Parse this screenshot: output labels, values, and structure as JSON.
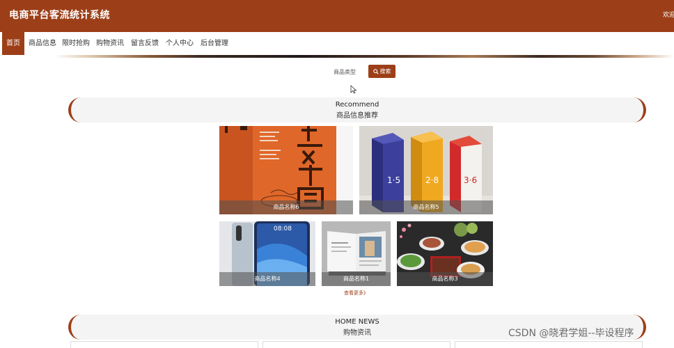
{
  "header": {
    "title": "电商平台客流统计系统",
    "welcome": "欢迎"
  },
  "nav": {
    "items": [
      {
        "label": "首页",
        "active": true
      },
      {
        "label": "商品信息"
      },
      {
        "label": "限时抢购"
      },
      {
        "label": "购物资讯"
      },
      {
        "label": "留言反馈"
      },
      {
        "label": "个人中心"
      },
      {
        "label": "后台管理"
      }
    ]
  },
  "search": {
    "label": "商品类型",
    "button_label": "搜索"
  },
  "recommend": {
    "title_en": "Recommend",
    "title_cn": "商品信息推荐",
    "products": [
      {
        "name": "商品名称6"
      },
      {
        "name": "商品名称5"
      },
      {
        "name": "商品名称4"
      },
      {
        "name": "商品名称1"
      },
      {
        "name": "商品名称3"
      }
    ],
    "more_label": "查看更多》"
  },
  "news": {
    "title_en": "HOME NEWS",
    "title_cn": "购物资讯"
  },
  "watermark": "CSDN @晓君学姐--毕设程序",
  "colors": {
    "brand": "#9c3f18",
    "section_bg": "#f4f4f4"
  }
}
